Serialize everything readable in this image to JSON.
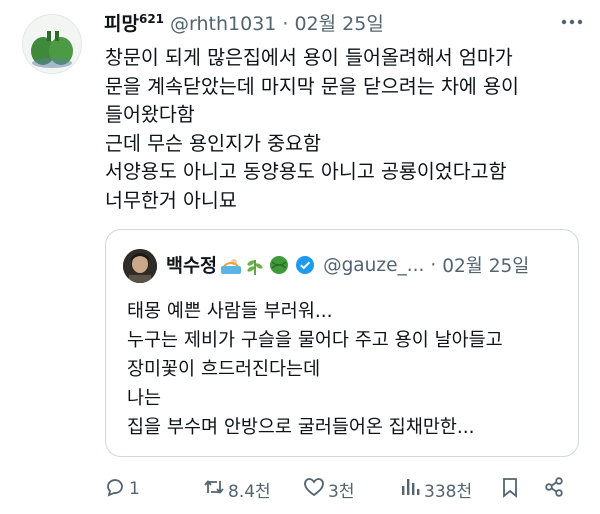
{
  "tweet": {
    "display_name": "피망",
    "name_superscript": "621",
    "handle": "@rhth1031",
    "separator": "·",
    "date": "02월 25일",
    "text_lines": [
      "창문이 되게 많은집에서 용이 들어올려해서 엄마가",
      "문을 계속닫았는데 마지막 문을 닫으려는 차에 용이",
      "들어왔다함",
      "근데 무슨 용인지가 중요함",
      "서양용도 아니고 동양용도 아니고 공룡이었다고함",
      "너무한거 아니묘"
    ]
  },
  "quote": {
    "display_name": "백수정",
    "name_emojis": [
      "swimmer-emoji",
      "herb-emoji",
      "yarn-ball-emoji"
    ],
    "handle": "@gauze_...",
    "separator": "·",
    "date": "02월 25일",
    "text_lines": [
      "태몽 예쁜 사람들 부러워...",
      "누구는 제비가 구슬을 물어다 주고 용이 날아들고",
      "장미꽃이 흐드러진다는데",
      "나는",
      "집을 부수며 안방으로 굴러들어온 집채만한..."
    ]
  },
  "actions": {
    "reply_count": "1",
    "retweet_count": "8.4천",
    "like_count": "3천",
    "view_count": "338천"
  },
  "colors": {
    "text": "#0f1419",
    "secondary": "#536471",
    "border": "#cfd9de",
    "verified": "#1d9bf0"
  }
}
